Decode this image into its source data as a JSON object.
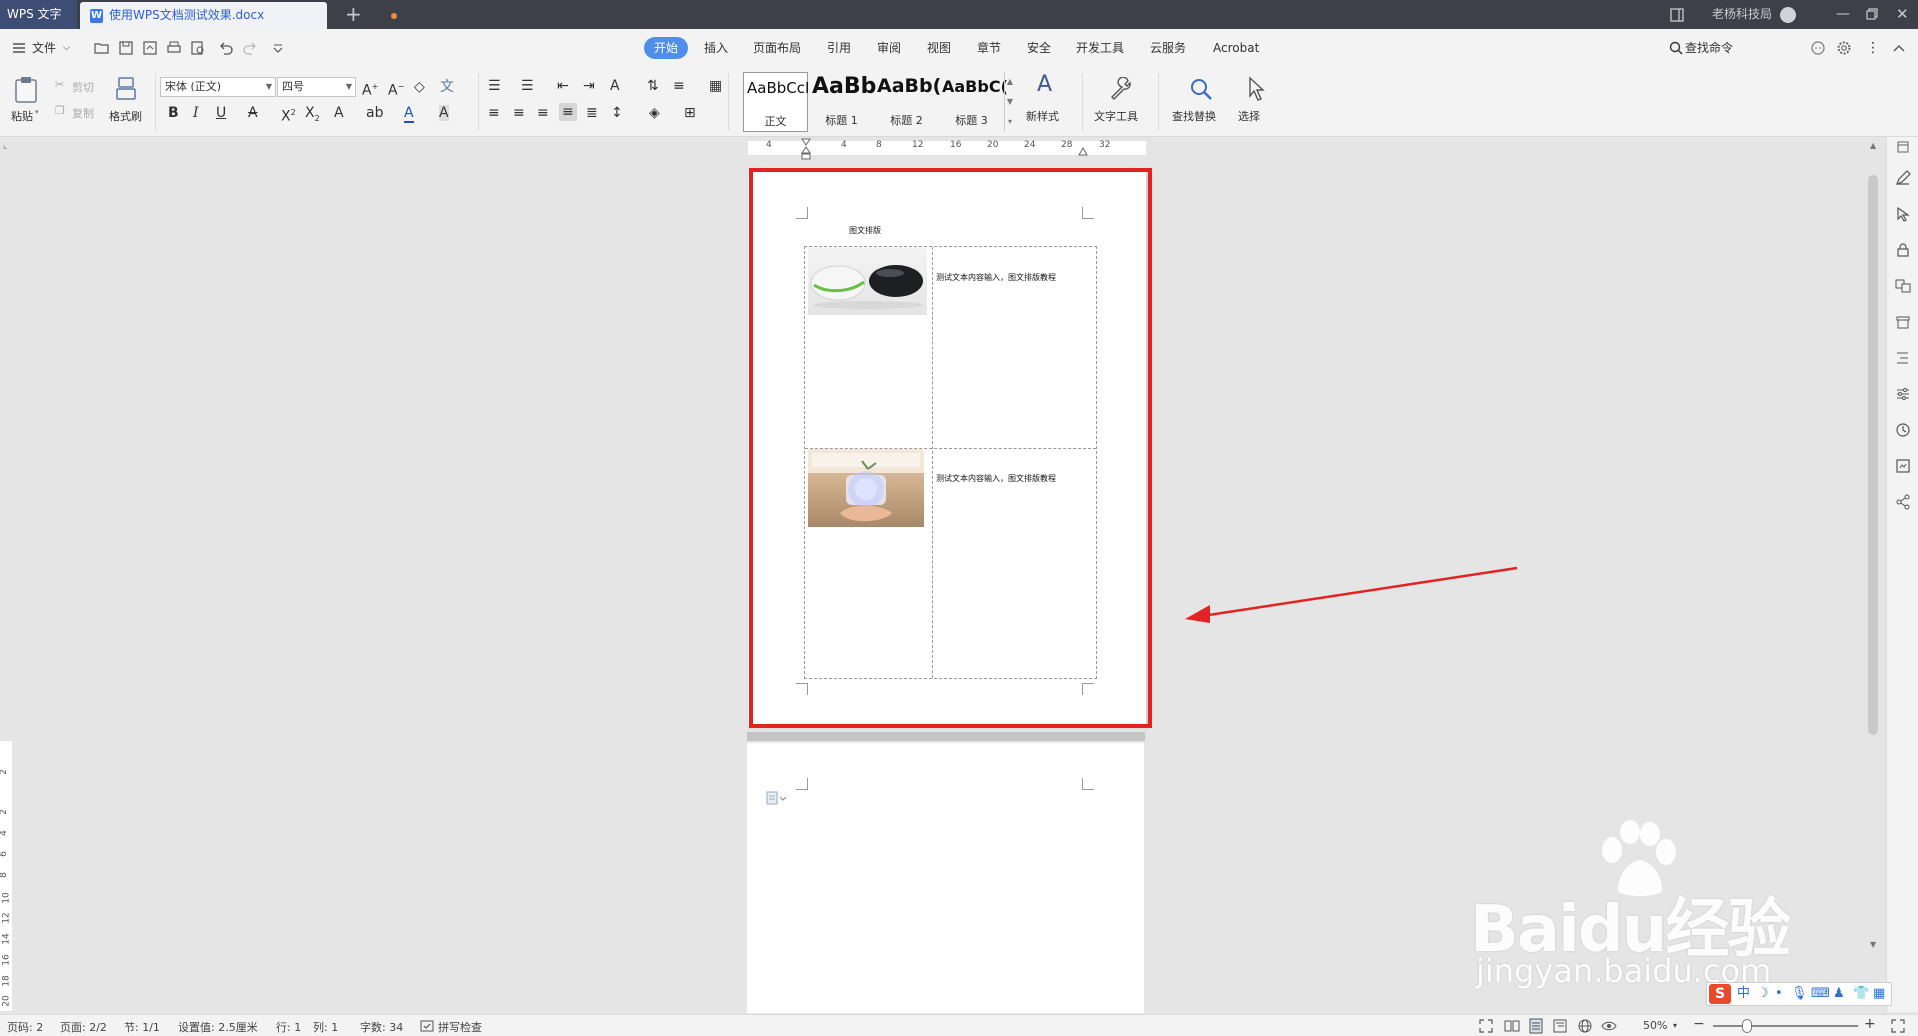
{
  "titlebar": {
    "app_name": "WPS 文字",
    "document_tab": "使用WPS文档测试效果.docx",
    "user_name": "老杨科技局"
  },
  "menubar": {
    "file_label": "文件",
    "tabs": [
      "开始",
      "插入",
      "页面布局",
      "引用",
      "审阅",
      "视图",
      "章节",
      "安全",
      "开发工具",
      "云服务",
      "Acrobat"
    ],
    "active_tab": "开始",
    "search_label": "查找命令"
  },
  "ribbon": {
    "paste": "粘贴",
    "cut": "剪切",
    "copy": "复制",
    "format_painter": "格式刷",
    "font_name": "宋体 (正文)",
    "font_size": "四号",
    "styles": [
      {
        "preview": "AaBbCcI",
        "name": "正文"
      },
      {
        "preview": "AaBb",
        "name": "标题 1"
      },
      {
        "preview": "AaBb(",
        "name": "标题 2"
      },
      {
        "preview": "AaBbC(",
        "name": "标题 3"
      }
    ],
    "new_style": "新样式",
    "text_tools": "文字工具",
    "find_replace": "查找替换",
    "select": "选择"
  },
  "ruler": {
    "h_ticks": [
      "4",
      "4",
      "8",
      "12",
      "16",
      "20",
      "24",
      "28",
      "32"
    ],
    "v_ticks": [
      "2",
      "2",
      "4",
      "6",
      "8",
      "10",
      "12",
      "14",
      "16",
      "18",
      "20"
    ]
  },
  "document": {
    "heading": "图文排版",
    "rows": [
      {
        "text": "测试文本内容输入，图文排版教程",
        "image": "computer mice photo"
      },
      {
        "text": "测试文本内容输入，图文排版教程",
        "image": "hand holding glowing jar photo"
      }
    ]
  },
  "watermark": {
    "brand": "Baidu经验",
    "url": "jingyan.baidu.com"
  },
  "ime": {
    "items": [
      "中",
      "ノ",
      "•"
    ]
  },
  "statusbar": {
    "page_no": "页码: 2",
    "pages": "页面: 2/2",
    "section": "节: 1/1",
    "setting": "设置值: 2.5厘米",
    "row": "行: 1",
    "col": "列: 1",
    "word_count": "字数: 34",
    "spell_check": "拼写检查",
    "zoom": "50%"
  },
  "colors": {
    "titlebar": "#3e4049",
    "accent": "#4f8ee9",
    "highlight_box": "#e52222",
    "annotation_arrow": "#e52222"
  }
}
